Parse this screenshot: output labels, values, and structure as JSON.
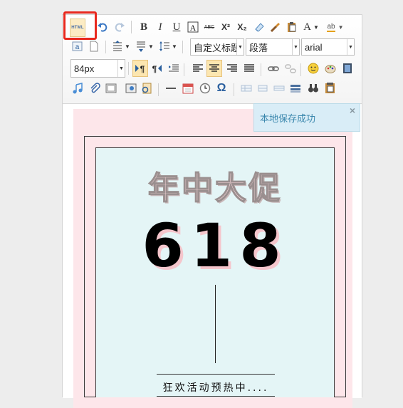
{
  "toolbar": {
    "html_button": "HTML",
    "row1": {
      "bold": "B",
      "italic": "I",
      "underline": "U",
      "strike_label": "ABC",
      "superscript": "X²",
      "subscript": "X₂",
      "font_color": "A",
      "spell": "ab"
    },
    "custom_title_select": "自定义标题",
    "paragraph_select": "段落",
    "font_family_select": "arial",
    "font_size_select": "84px",
    "omega": "Ω"
  },
  "poster": {
    "title": "年中大促",
    "big_number": "618",
    "subtitle": "狂欢活动预热中...."
  },
  "toast": {
    "message": "本地保存成功",
    "close": "×"
  },
  "colors": {
    "highlight": "#e8281e",
    "poster_bg": "#fde6ea",
    "inner_bg": "#e4f5f6",
    "toast_bg": "#d9edf7"
  }
}
